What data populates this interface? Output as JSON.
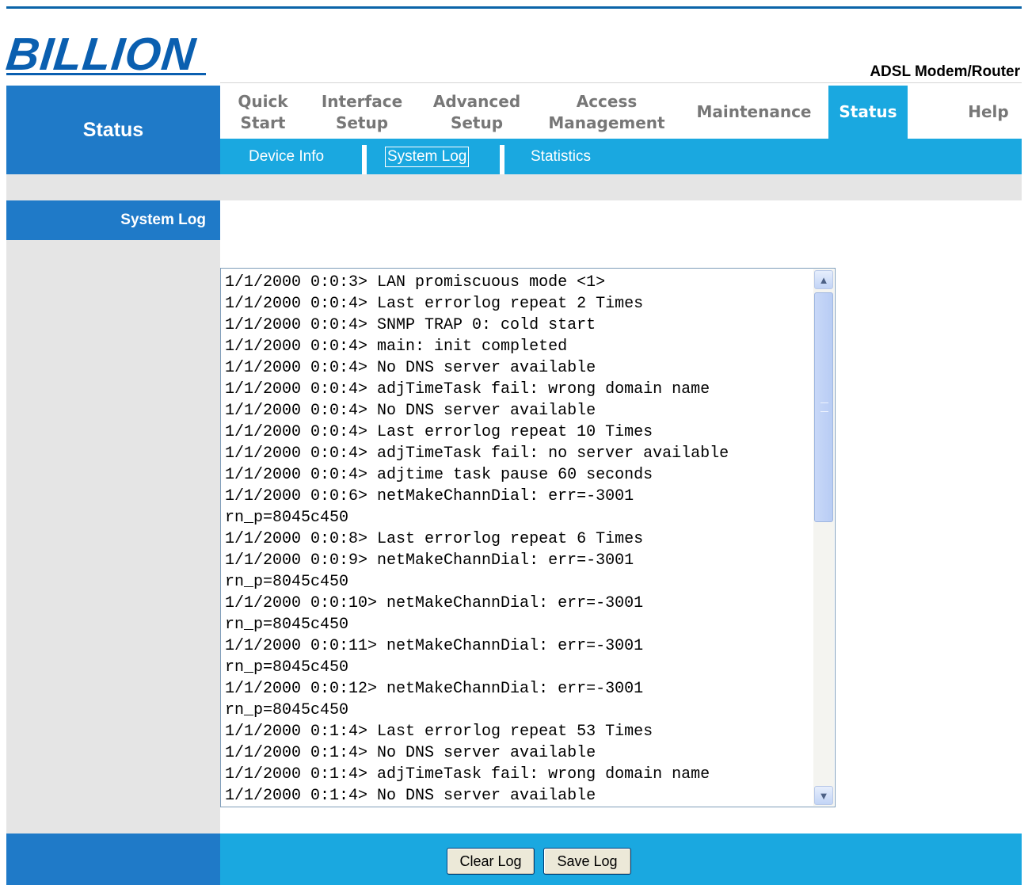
{
  "brand": {
    "logo": "BILLION",
    "product": "ADSL Modem/Router"
  },
  "sidebar": {
    "section": "Status",
    "item": "System Log"
  },
  "nav": [
    {
      "line1": "Quick",
      "line2": "Start"
    },
    {
      "line1": "Interface",
      "line2": "Setup"
    },
    {
      "line1": "Advanced",
      "line2": "Setup"
    },
    {
      "line1": "Access",
      "line2": "Management"
    },
    {
      "line1": "Maintenance",
      "line2": ""
    },
    {
      "line1": "Status",
      "line2": ""
    },
    {
      "line1": "Help",
      "line2": ""
    }
  ],
  "active_nav": "Status",
  "subnav": [
    "Device Info",
    "System Log",
    "Statistics"
  ],
  "active_subnav": "System Log",
  "log_lines": [
    "1/1/2000 0:0:3> LAN promiscuous mode <1>",
    "1/1/2000 0:0:4> Last errorlog repeat 2 Times",
    "1/1/2000 0:0:4> SNMP TRAP 0: cold start",
    "1/1/2000 0:0:4> main: init completed",
    "1/1/2000 0:0:4> No DNS server available",
    "1/1/2000 0:0:4> adjTimeTask fail: wrong domain name",
    "1/1/2000 0:0:4> No DNS server available",
    "1/1/2000 0:0:4> Last errorlog repeat 10 Times",
    "1/1/2000 0:0:4> adjTimeTask fail: no server available",
    "1/1/2000 0:0:4> adjtime task pause 60 seconds",
    "1/1/2000 0:0:6> netMakeChannDial: err=-3001",
    "rn_p=8045c450",
    "1/1/2000 0:0:8> Last errorlog repeat 6 Times",
    "1/1/2000 0:0:9> netMakeChannDial: err=-3001",
    "rn_p=8045c450",
    "1/1/2000 0:0:10> netMakeChannDial: err=-3001",
    "rn_p=8045c450",
    "1/1/2000 0:0:11> netMakeChannDial: err=-3001",
    "rn_p=8045c450",
    "1/1/2000 0:0:12> netMakeChannDial: err=-3001",
    "rn_p=8045c450",
    "1/1/2000 0:1:4> Last errorlog repeat 53 Times",
    "1/1/2000 0:1:4> No DNS server available",
    "1/1/2000 0:1:4> adjTimeTask fail: wrong domain name",
    "1/1/2000 0:1:4> No DNS server available"
  ],
  "buttons": {
    "clear": "Clear Log",
    "save": "Save Log"
  },
  "icons": {
    "scroll_up": "chevron-up-icon",
    "scroll_down": "chevron-down-icon"
  },
  "colors": {
    "dark_blue": "#1f7ac8",
    "light_blue": "#1aa8e0",
    "logo_blue": "#0a5fb0",
    "grey": "#e5e5e5"
  }
}
